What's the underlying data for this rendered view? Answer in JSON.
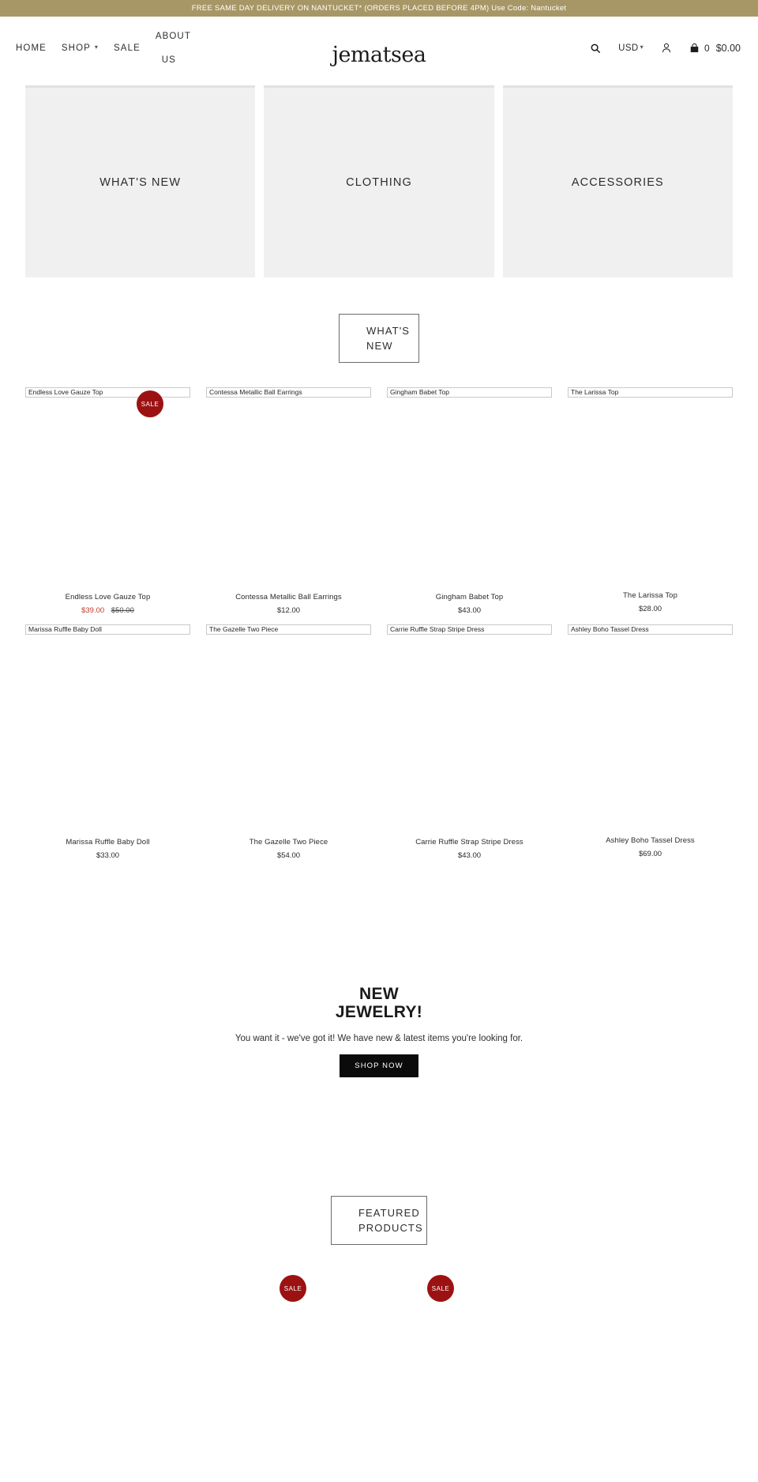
{
  "announcement": {
    "text": "FREE SAME DAY DELIVERY ON NANTUCKET* (ORDERS PLACED BEFORE 4PM) Use Code: Nantucket",
    "background": "#a89766"
  },
  "header": {
    "logo": "jematsea",
    "nav": [
      {
        "label": "HOME",
        "has_caret": false
      },
      {
        "label": "SHOP",
        "has_caret": true
      },
      {
        "label": "SALE",
        "has_caret": false
      },
      {
        "label": "ABOUT US",
        "has_caret": false
      }
    ],
    "search_icon": "search-icon",
    "currency": "USD",
    "account_icon": "account-icon",
    "cart_icon": "cart-icon",
    "cart_count": "0",
    "cart_total": "$0.00"
  },
  "tiles": [
    {
      "label": "WHAT'S NEW"
    },
    {
      "label": "CLOTHING"
    },
    {
      "label": "ACCESSORIES"
    }
  ],
  "sections": {
    "whats_new_heading": "WHAT'S NEW",
    "featured_heading": "FEATURED PRODUCTS"
  },
  "products_row1": [
    {
      "name": "Endless Love Gauze Top",
      "price": "$39.00",
      "compare_at": "$50.00",
      "on_sale": true,
      "badge": "SALE"
    },
    {
      "name": "Contessa Metallic Ball Earrings",
      "price": "$12.00",
      "compare_at": "",
      "on_sale": false,
      "badge": ""
    },
    {
      "name": "Gingham Babet Top",
      "price": "$43.00",
      "compare_at": "",
      "on_sale": false,
      "badge": ""
    },
    {
      "name": "The Larissa Top",
      "price": "$28.00",
      "compare_at": "",
      "on_sale": false,
      "badge": ""
    }
  ],
  "products_row2": [
    {
      "name": "Marissa Ruffle Baby Doll",
      "price": "$33.00",
      "compare_at": "",
      "on_sale": false,
      "badge": ""
    },
    {
      "name": "The Gazelle Two Piece",
      "price": "$54.00",
      "compare_at": "",
      "on_sale": false,
      "badge": ""
    },
    {
      "name": "Carrie Ruffle Strap Stripe Dress",
      "price": "$43.00",
      "compare_at": "",
      "on_sale": false,
      "badge": ""
    },
    {
      "name": "Ashley Boho Tassel Dress",
      "price": "$69.00",
      "compare_at": "",
      "on_sale": false,
      "badge": ""
    }
  ],
  "promo": {
    "line1": "NEW",
    "line2": "JEWELRY!",
    "subtitle": "You want it - we've got it! We have new & latest items you're looking for.",
    "button": "SHOP NOW"
  },
  "featured_badges": [
    {
      "label": "SALE"
    },
    {
      "label": "SALE"
    }
  ],
  "colors": {
    "accent": "#a89766",
    "sale_red": "#9c1212",
    "sale_price": "#c0392b",
    "tile_bg": "#f0f0f0"
  }
}
